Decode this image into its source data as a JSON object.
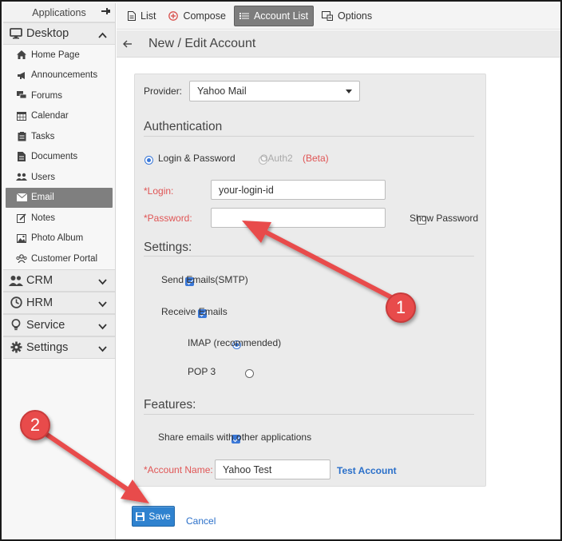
{
  "sidebar": {
    "header": "Applications",
    "sections": {
      "desktop": "Desktop",
      "crm": "CRM",
      "hrm": "HRM",
      "service": "Service",
      "settings": "Settings"
    },
    "items": [
      {
        "label": "Home Page",
        "icon": "home-icon"
      },
      {
        "label": "Announcements",
        "icon": "megaphone-icon"
      },
      {
        "label": "Forums",
        "icon": "forum-icon"
      },
      {
        "label": "Calendar",
        "icon": "calendar-icon"
      },
      {
        "label": "Tasks",
        "icon": "tasks-icon"
      },
      {
        "label": "Documents",
        "icon": "document-icon"
      },
      {
        "label": "Users",
        "icon": "users-icon"
      },
      {
        "label": "Email",
        "icon": "email-icon",
        "active": true
      },
      {
        "label": "Notes",
        "icon": "notes-icon"
      },
      {
        "label": "Photo Album",
        "icon": "photo-icon"
      },
      {
        "label": "Customer Portal",
        "icon": "portal-icon"
      }
    ]
  },
  "toolbar": {
    "list": "List",
    "compose": "Compose",
    "account_list": "Account List",
    "options": "Options"
  },
  "page": {
    "title": "New / Edit Account"
  },
  "form": {
    "provider_label": "Provider:",
    "provider_value": "Yahoo Mail",
    "auth_heading": "Authentication",
    "auth_login_password": "Login & Password",
    "auth_oauth2": "OAuth2",
    "auth_beta": "(Beta)",
    "login_label": "*Login:",
    "login_value": "your-login-id",
    "password_label": "*Password:",
    "password_value": "",
    "show_password": "Show Password",
    "settings_heading": "Settings:",
    "send_emails": "Send Emails(SMTP)",
    "receive_emails": "Receive Emails",
    "imap": "IMAP (recommended)",
    "pop3": "POP 3",
    "features_heading": "Features:",
    "share_emails": "Share emails with other applications",
    "account_name_label": "*Account Name:",
    "account_name_value": "Yahoo Test",
    "test_account": "Test Account"
  },
  "actions": {
    "save": "Save",
    "cancel": "Cancel"
  },
  "annotations": {
    "step1": "1",
    "step2": "2"
  },
  "colors": {
    "accent": "#2f82cf",
    "required": "#e05555",
    "annotation": "#e84b4b",
    "active_nav": "#7f7f7f"
  }
}
